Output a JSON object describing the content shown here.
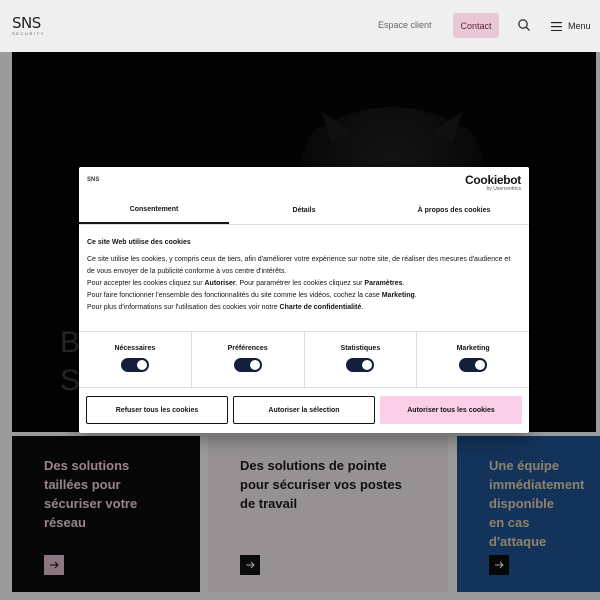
{
  "header": {
    "logo_text": "SNS",
    "logo_sub": "SECURITY",
    "client_link": "Espace client",
    "contact_button": "Contact",
    "menu_label": "Menu"
  },
  "hero": {
    "title_line1": "B",
    "title_line2": "S"
  },
  "cards": [
    {
      "title": "Des solutions taillées pour sécuriser votre réseau"
    },
    {
      "title": "Des solutions de pointe pour sécuriser vos postes de travail"
    },
    {
      "title": "Une équipe immédiatement disponible en cas d'attaque"
    }
  ],
  "cookie_dialog": {
    "brand": "SNS",
    "provider": "Cookiebot",
    "provider_sub": "by Usercentrics",
    "tabs": [
      "Consentement",
      "Détails",
      "À propos des cookies"
    ],
    "heading": "Ce site Web utilise des cookies",
    "paragraph_1": "Ce site utilise les cookies, y compris ceux de tiers, afin d'améliorer votre expérience sur notre site, de réaliser des mesures d'audience et de vous envoyer de la publicité conforme à vos centre d'intérêts.",
    "line_2_prefix": "Pour accepter les cookies cliquez sur ",
    "line_2_b1": "Autoriser",
    "line_2_mid": ". Pour paramétrer les cookies cliquez sur ",
    "line_2_b2": "Paramètres",
    "line_2_end": ".",
    "line_3_prefix": "Pour faire fonctionner l'ensemble des fonctionnalités du site comme les vidéos, cochez la case ",
    "line_3_b": "Marketing",
    "line_3_end": ".",
    "line_4_prefix": "Pour plus d'informations sur l'utilisation des cookies voir notre ",
    "line_4_b": "Charte de confidentialité",
    "line_4_end": ".",
    "toggles": [
      {
        "label": "Nécessaires",
        "on": true
      },
      {
        "label": "Préférences",
        "on": true
      },
      {
        "label": "Statistiques",
        "on": true
      },
      {
        "label": "Marketing",
        "on": true
      }
    ],
    "buttons": {
      "refuse": "Refuser tous les cookies",
      "allow_selection": "Autoriser la sélection",
      "allow_all": "Autoriser tous les cookies"
    }
  },
  "colors": {
    "contact_bg": "#e8c8d6",
    "accept_bg": "#fbcfe8",
    "toggle_on": "#141f3c",
    "card_blue": "#1e4f8a"
  }
}
